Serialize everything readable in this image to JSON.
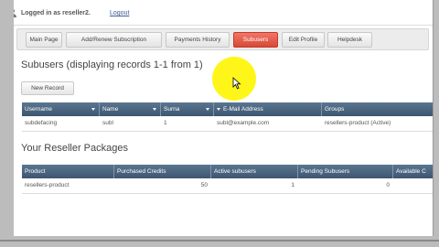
{
  "header": {
    "login_text": "Logged in as reseller2.",
    "logout_label": "Logout"
  },
  "nav": {
    "tabs": [
      {
        "label": "Main Page",
        "active": false
      },
      {
        "label": "Add/Renew Subscription",
        "active": false
      },
      {
        "label": "Payments History",
        "active": false
      },
      {
        "label": "Subusers",
        "active": true
      },
      {
        "label": "Edit Profile",
        "active": false
      },
      {
        "label": "Helpdesk",
        "active": false
      }
    ]
  },
  "subusers": {
    "title": "Subusers (displaying records 1-1 from 1)",
    "new_record_label": "New Record",
    "columns": [
      "Username",
      "Name",
      "Surna",
      "E-Mail Address",
      "Groups"
    ],
    "rows": [
      [
        "subdefacing",
        "subl",
        "1",
        "subl@example.com",
        "resellers-product (Active)"
      ]
    ]
  },
  "packages": {
    "title": "Your Reseller Packages",
    "columns": [
      "Product",
      "Purchased Credits",
      "Active subusers",
      "Pending Subusers",
      "Available C"
    ],
    "rows": [
      [
        "resellers-product",
        "50",
        "1",
        "0",
        ""
      ]
    ]
  },
  "colors": {
    "accent": "#d84835",
    "table_header": "#4a637d",
    "cursor_highlight": "#fff500"
  }
}
